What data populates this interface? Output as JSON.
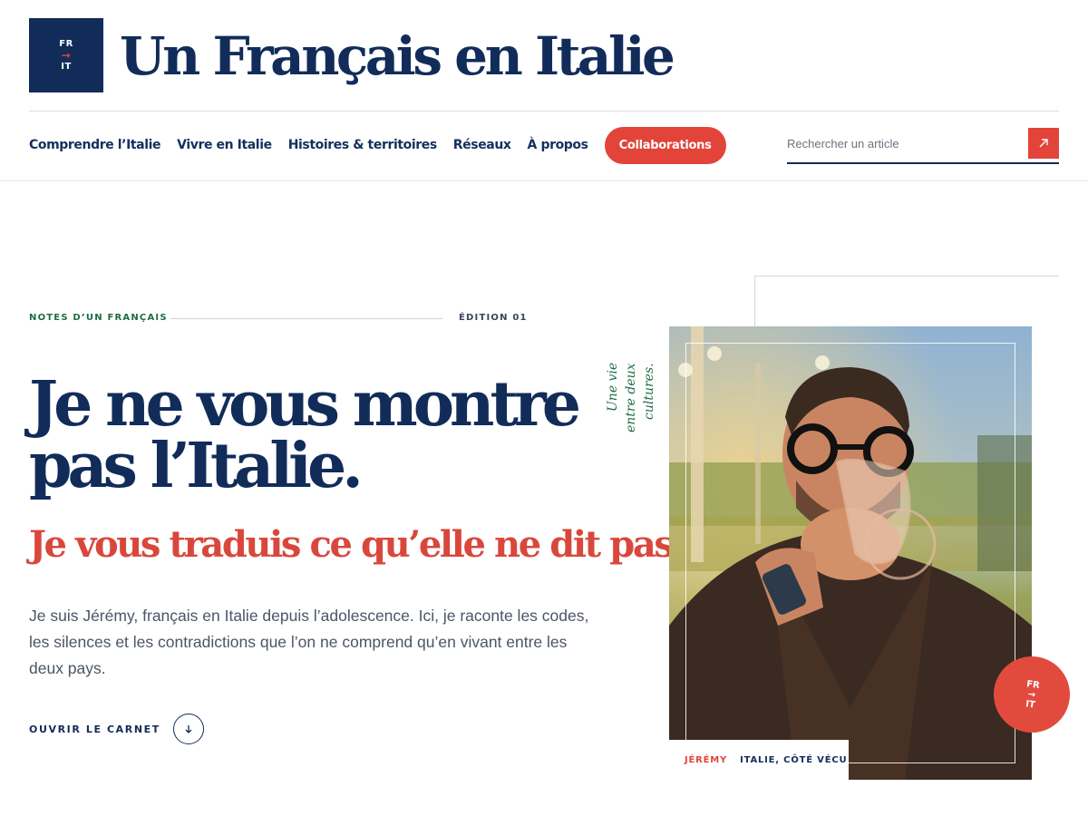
{
  "logo": {
    "top": "FR",
    "arrow": "→",
    "bottom": "IT"
  },
  "site_title": "Un Français en Italie",
  "nav": {
    "items": [
      {
        "label": "Comprendre l’Italie"
      },
      {
        "label": "Vivre en Italie"
      },
      {
        "label": "Histoires & territoires"
      },
      {
        "label": "Réseaux"
      },
      {
        "label": "À propos"
      }
    ],
    "cta_label": "Collaborations"
  },
  "search": {
    "placeholder": "Rechercher un article",
    "icon": "arrow-up-right-icon"
  },
  "hero": {
    "eyebrow_left": "NOTES D’UN FRANÇAIS",
    "eyebrow_right": "ÉDITION 01",
    "headline": "Je ne vous montre pas l’Italie.",
    "subheadline": "Je vous traduis ce qu’elle ne dit pas.",
    "intro": "Je suis Jérémy, français en Italie depuis l’adolescence. Ici, je raconte les codes, les silences et les contradictions que l’on ne comprend qu’en vivant entre les deux pays.",
    "cta_label": "OUVRIR LE CARNET",
    "cta_icon": "arrow-down-icon"
  },
  "photo": {
    "vertical_quote": "Une vie entre deux cultures.",
    "caption_name": "JÉRÉMY",
    "caption_place": "ITALIE, CÔTÉ VÉCU",
    "badge": {
      "top": "FR",
      "arrow": "→",
      "bottom": "IT"
    }
  },
  "colors": {
    "navy": "#122c5a",
    "accent_red": "#e2443a",
    "green": "#1e6b45"
  }
}
